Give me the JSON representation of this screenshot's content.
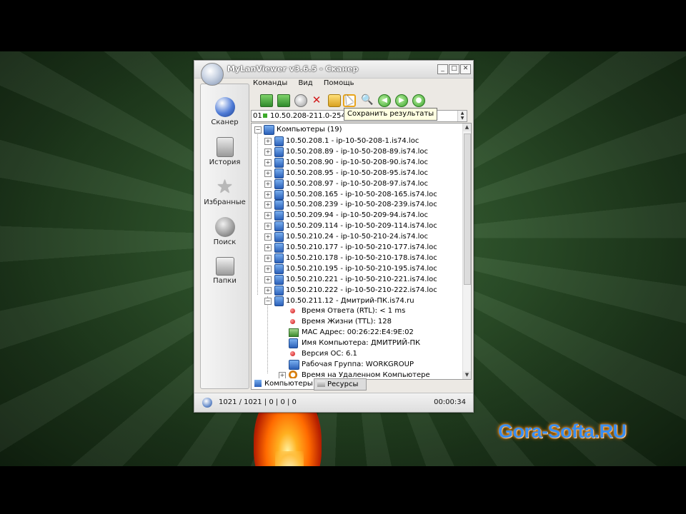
{
  "window": {
    "title": "MyLanViewer v3.6.5 - Сканер",
    "controls": [
      "_",
      "□",
      "✕"
    ]
  },
  "menu": [
    "Команды",
    "Вид",
    "Помощь"
  ],
  "sidebar": {
    "items": [
      {
        "label": "Сканер",
        "icon": "scanner-globe-icon"
      },
      {
        "label": "История",
        "icon": "history-icon"
      },
      {
        "label": "Избранные",
        "icon": "favorites-star-icon"
      },
      {
        "label": "Поиск",
        "icon": "search-icon"
      },
      {
        "label": "Папки",
        "icon": "folders-icon"
      }
    ]
  },
  "toolbar": {
    "tooltip": "Сохранить результаты"
  },
  "range": {
    "prefix": "01",
    "value": "10.50.208-211.0-254"
  },
  "tree": {
    "root": "Компьютеры (19)",
    "hosts": [
      "10.50.208.1 - ip-10-50-208-1.is74.loc",
      "10.50.208.89 - ip-10-50-208-89.is74.loc",
      "10.50.208.90 - ip-10-50-208-90.is74.loc",
      "10.50.208.95 - ip-10-50-208-95.is74.loc",
      "10.50.208.97 - ip-10-50-208-97.is74.loc",
      "10.50.208.165 - ip-10-50-208-165.is74.loc",
      "10.50.208.239 - ip-10-50-208-239.is74.loc",
      "10.50.209.94 - ip-10-50-209-94.is74.loc",
      "10.50.209.114 - ip-10-50-209-114.is74.loc",
      "10.50.210.24 - ip-10-50-210-24.is74.loc",
      "10.50.210.177 - ip-10-50-210-177.is74.loc",
      "10.50.210.178 - ip-10-50-210-178.is74.loc",
      "10.50.210.195 - ip-10-50-210-195.is74.loc",
      "10.50.210.221 - ip-10-50-210-221.is74.loc",
      "10.50.210.222 - ip-10-50-210-222.is74.loc",
      "10.50.211.12 - Дмитрий-ПК.is74.ru"
    ],
    "details": [
      "Время Ответа (RTL): < 1 ms",
      "Время Жизни (TTL): 128",
      "MAC Адрес: 00:26:22:E4:9E:02",
      "Имя Компьютера: ДМИТРИЙ-ПК",
      "Версия ОС: 6.1",
      "Рабочая Группа: WORKGROUP",
      "Время на Удаленном Компьютере"
    ]
  },
  "tabs": [
    "Компьютеры",
    "Ресурсы"
  ],
  "status": {
    "counts": "1021 / 1021 | 0 | 0 | 0",
    "time": "00:00:34"
  },
  "watermark": "Gora-Softa.RU",
  "colors": {
    "accent_blue": "#2a5fb8",
    "watermark_blue": "#3a8ef0",
    "watermark_glow": "#ff7a00"
  }
}
